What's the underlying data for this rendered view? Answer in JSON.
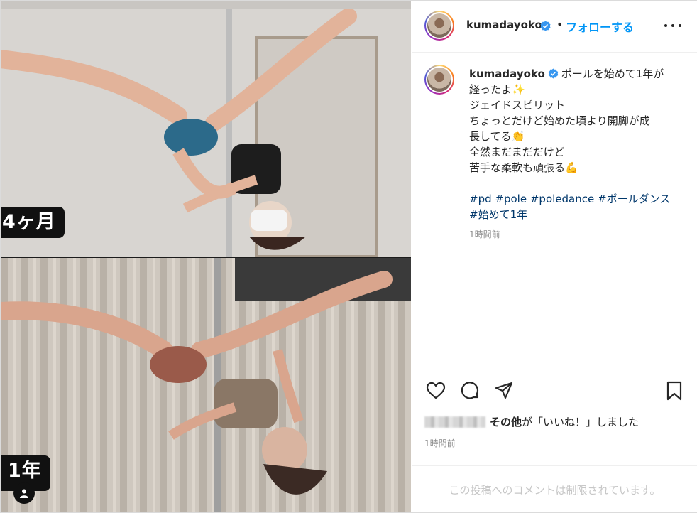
{
  "media": {
    "top_label": "4ヶ月",
    "bottom_label": "1年"
  },
  "header": {
    "username": "kumadayoko",
    "separator": "•",
    "follow_label": "フォローする"
  },
  "post": {
    "username": "kumadayoko",
    "lines": [
      "ポールを始めて1年が",
      "経ったよ✨",
      "ジェイドスピリット",
      "ちょっとだけど始めた頃より開脚が成",
      "長してる👏",
      "全然まだまだだけど",
      "苦手な柔軟も頑張る💪"
    ],
    "hashtags": [
      "#pd",
      "#pole",
      "#poledance",
      "#ポールダンス",
      "#始めて1年"
    ],
    "time": "1時間前"
  },
  "likes": {
    "others": "その他",
    "suffix": "が「いいね！」しました",
    "time": "1時間前"
  },
  "comments_notice": "この投稿へのコメントは制限されています。",
  "colors": {
    "link": "#0095f6",
    "hashtag": "#00376b",
    "muted": "#8e8e8e",
    "verified": "#3897f0"
  },
  "icons": [
    "verified-icon",
    "more-options-icon",
    "heart-icon",
    "comment-icon",
    "share-icon",
    "bookmark-icon",
    "user-tag-icon"
  ]
}
